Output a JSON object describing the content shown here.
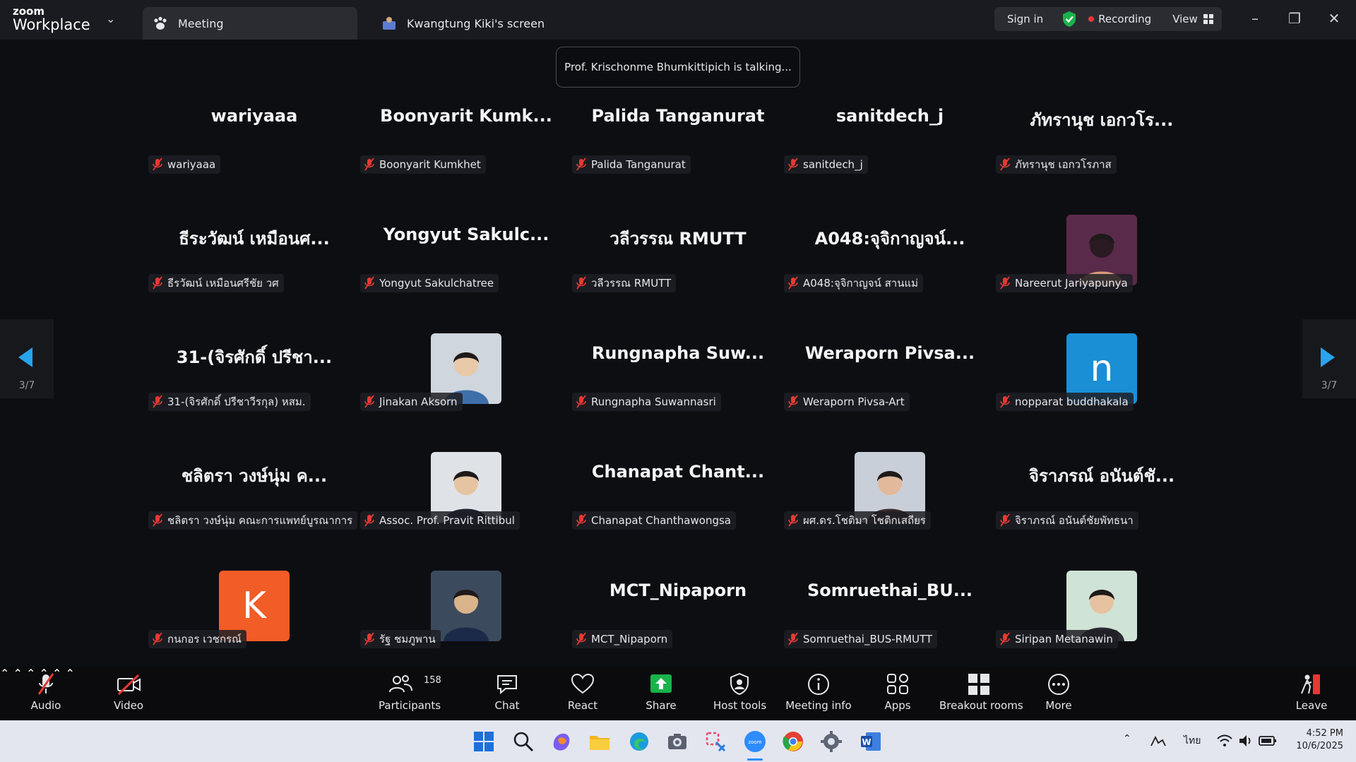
{
  "app": {
    "logo_top": "zoom",
    "logo_bottom": "Workplace"
  },
  "tabs": [
    {
      "label": "Meeting"
    },
    {
      "label": "Kwangtung Kiki's screen"
    }
  ],
  "header": {
    "sign_in": "Sign in",
    "recording": "Recording",
    "view": "View"
  },
  "talking_banner": "Prof. Krischonme Bhumkittipich is talking...",
  "pager": {
    "left": "3/7",
    "right": "3/7"
  },
  "tiles": [
    {
      "big": "wariyaaa",
      "label": "wariyaaa",
      "avatar": "none"
    },
    {
      "big": "Boonyarit  Kumk...",
      "label": "Boonyarit Kumkhet",
      "avatar": "none"
    },
    {
      "big": "Palida Tanganurat",
      "label": "Palida Tanganurat",
      "avatar": "none"
    },
    {
      "big": "sanitdech_j",
      "label": "sanitdech_j",
      "avatar": "none"
    },
    {
      "big": "ภัทรานุช เอกวโร...",
      "label": "ภัทรานุช เอกวโรภาส",
      "avatar": "none"
    },
    {
      "big": "ธีระวัฒน์ เหมือนศ...",
      "label": "ธีรวัฒน์ เหมือนศรีชัย วศ",
      "avatar": "none"
    },
    {
      "big": "Yongyut  Sakulc...",
      "label": "Yongyut Sakulchatree",
      "avatar": "none"
    },
    {
      "big": "วลีวรรณ RMUTT",
      "label": "วลีวรรณ RMUTT",
      "avatar": "none"
    },
    {
      "big": "A048:จุจิกาญจน์...",
      "label": "A048:จุจิกาญจน์ สานแม่",
      "avatar": "none"
    },
    {
      "big": "",
      "label": "Nareerut Jariyapunya",
      "avatar": "photo"
    },
    {
      "big": "31-(จิรศักดิ์ ปรีชา...",
      "label": "31-(จิรศักดิ์ ปรีชาวีรกุล) หสม.",
      "avatar": "none"
    },
    {
      "big": "",
      "label": "Jinakan Aksorn",
      "avatar": "photo"
    },
    {
      "big": "Rungnapha  Suw...",
      "label": "Rungnapha Suwannasri",
      "avatar": "none"
    },
    {
      "big": "Weraporn  Pivsa...",
      "label": "Weraporn Pivsa-Art",
      "avatar": "none"
    },
    {
      "big": "",
      "label": "nopparat buddhakala",
      "avatar": "letter",
      "letter": "n",
      "color": "#1a8fd6"
    },
    {
      "big": "ชลิตรา วงษ์นุ่ม ค...",
      "label": "ชลิตรา วงษ์นุ่ม คณะการแพทย์บูรณาการ",
      "avatar": "none"
    },
    {
      "big": "",
      "label": "Assoc. Prof. Pravit Rittibul",
      "avatar": "photo"
    },
    {
      "big": "Chanapat  Chant...",
      "label": "Chanapat Chanthawongsa",
      "avatar": "none"
    },
    {
      "big": "",
      "label": "ผศ.ดร.โชติมา โชติกเสถียร",
      "avatar": "photo"
    },
    {
      "big": "จิราภรณ์ อนันต์ชั...",
      "label": "จิราภรณ์ อนันต์ชัยพัทธนา",
      "avatar": "none"
    },
    {
      "big": "",
      "label": "กนกอร เวชกรณ์",
      "avatar": "letter",
      "letter": "K",
      "color": "#f25c26"
    },
    {
      "big": "",
      "label": "รัฐ ชมภูพาน",
      "avatar": "photo"
    },
    {
      "big": "MCT_Nipaporn",
      "label": "MCT_Nipaporn",
      "avatar": "none"
    },
    {
      "big": "Somruethai_BU...",
      "label": "Somruethai_BUS-RMUTT",
      "avatar": "none"
    },
    {
      "big": "",
      "label": "Siripan Metanawin",
      "avatar": "photo"
    }
  ],
  "toolbar": {
    "audio": "Audio",
    "video": "Video",
    "participants": "Participants",
    "participants_count": "158",
    "chat": "Chat",
    "react": "React",
    "share": "Share",
    "host_tools": "Host tools",
    "meeting_info": "Meeting info",
    "apps": "Apps",
    "breakout_rooms": "Breakout rooms",
    "more": "More",
    "leave": "Leave"
  },
  "taskbar": {
    "lang": "ไทย",
    "time": "4:52 PM",
    "date": "10/6/2025"
  }
}
